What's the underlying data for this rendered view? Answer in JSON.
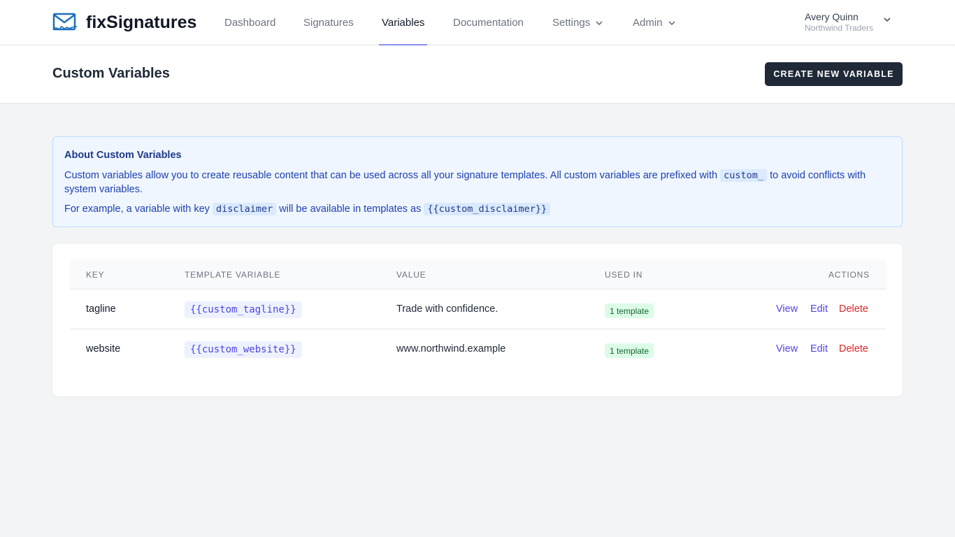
{
  "app": {
    "name": "fixSignatures"
  },
  "nav": {
    "items": [
      {
        "label": "Dashboard"
      },
      {
        "label": "Signatures"
      },
      {
        "label": "Variables",
        "active": true
      },
      {
        "label": "Documentation"
      },
      {
        "label": "Settings",
        "dropdown": true
      },
      {
        "label": "Admin",
        "dropdown": true
      }
    ]
  },
  "user": {
    "name": "Avery Quinn",
    "org": "Northwind Traders"
  },
  "page": {
    "title": "Custom Variables",
    "create_button": "CREATE NEW VARIABLE"
  },
  "info": {
    "title": "About Custom Variables",
    "p1_before": "Custom variables allow you to create reusable content that can be used across all your signature templates. All custom variables are prefixed with",
    "p1_code": "custom_",
    "p1_after": "to avoid conflicts with system variables.",
    "p2_before": "For example, a variable with key",
    "p2_code1": "disclaimer",
    "p2_middle": "will be available in templates as",
    "p2_code2": "{{custom_disclaimer}}"
  },
  "table": {
    "headers": {
      "key": "KEY",
      "template_variable": "TEMPLATE VARIABLE",
      "value": "VALUE",
      "used_in": "USED IN",
      "actions": "ACTIONS"
    },
    "rows": [
      {
        "key": "tagline",
        "template_variable": "{{custom_tagline}}",
        "value": "Trade with confidence.",
        "used_in": "1 template",
        "view": "View",
        "edit": "Edit",
        "delete": "Delete"
      },
      {
        "key": "website",
        "template_variable": "{{custom_website}}",
        "value": "www.northwind.example",
        "used_in": "1 template",
        "view": "View",
        "edit": "Edit",
        "delete": "Delete"
      }
    ]
  },
  "colors": {
    "accent": "#6366f1",
    "primary_button": "#1f2937",
    "danger": "#dc2626",
    "badge_bg": "#dcfce7",
    "info_bg": "#eff6ff"
  },
  "icons": {
    "logo": "envelope-signature-icon",
    "dropdown": "chevron-down-icon"
  }
}
